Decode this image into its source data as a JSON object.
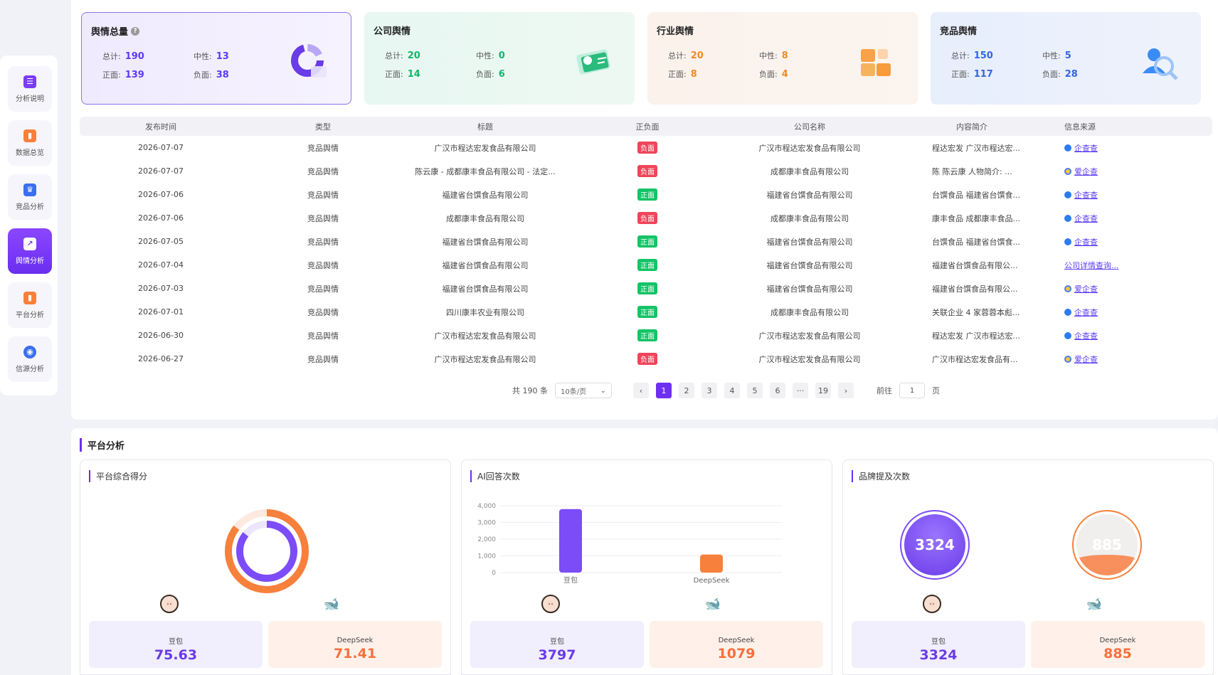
{
  "sidebar": {
    "items": [
      {
        "label": "分析说明",
        "icon": "document-icon",
        "color": "#7b3cf5",
        "active": false
      },
      {
        "label": "数据总览",
        "icon": "bar-chart-icon",
        "color": "#f7803c",
        "active": false
      },
      {
        "label": "竞品分析",
        "icon": "trophy-icon",
        "color": "#3b6ef0",
        "active": false
      },
      {
        "label": "舆情分析",
        "icon": "trend-icon",
        "color": "#ffffff",
        "active": true
      },
      {
        "label": "平台分析",
        "icon": "bar-chart-icon",
        "color": "#f7803c",
        "active": false
      },
      {
        "label": "信源分析",
        "icon": "signal-icon",
        "color": "#3b6ef0",
        "active": false
      }
    ]
  },
  "cards": [
    {
      "title": "舆情总量",
      "help": "?",
      "total_label": "总计:",
      "total": "190",
      "neutral_label": "中性:",
      "neutral": "13",
      "pos_label": "正面:",
      "pos": "139",
      "neg_label": "负面:",
      "neg": "38",
      "color": "#5b3cf5"
    },
    {
      "title": "公司舆情",
      "total_label": "总计:",
      "total": "20",
      "neutral_label": "中性:",
      "neutral": "0",
      "pos_label": "正面:",
      "pos": "14",
      "neg_label": "负面:",
      "neg": "6",
      "color": "#10b76a"
    },
    {
      "title": "行业舆情",
      "total_label": "总计:",
      "total": "20",
      "neutral_label": "中性:",
      "neutral": "8",
      "pos_label": "正面:",
      "pos": "8",
      "neg_label": "负面:",
      "neg": "4",
      "color": "#f58a1f"
    },
    {
      "title": "竞品舆情",
      "total_label": "总计:",
      "total": "150",
      "neutral_label": "中性:",
      "neutral": "5",
      "pos_label": "正面:",
      "pos": "117",
      "neg_label": "负面:",
      "neg": "28",
      "color": "#3366e0"
    }
  ],
  "table": {
    "headers": [
      "发布时间",
      "类型",
      "标题",
      "正负面",
      "公司名称",
      "内容简介",
      "信息来源"
    ],
    "rows": [
      {
        "date": "2026-07-07",
        "type": "竞品舆情",
        "title": "广汉市程达宏发食品有限公司",
        "sentiment": "负面",
        "company": "广汉市程达宏发食品有限公司",
        "summary": "程达宏发 广汉市程达宏...",
        "source": "企查查"
      },
      {
        "date": "2026-07-07",
        "type": "竞品舆情",
        "title": "陈云康 - 成都康丰食品有限公司 - 法定...",
        "sentiment": "负面",
        "company": "成都康丰食品有限公司",
        "summary": "陈 陈云康 人物简介: ...",
        "source": "爱企查"
      },
      {
        "date": "2026-07-06",
        "type": "竞品舆情",
        "title": "福建省台馔食品有限公司",
        "sentiment": "正面",
        "company": "福建省台馔食品有限公司",
        "summary": "台馔食品 福建省台馔食...",
        "source": "企查查"
      },
      {
        "date": "2026-07-06",
        "type": "竞品舆情",
        "title": "成都康丰食品有限公司",
        "sentiment": "负面",
        "company": "成都康丰食品有限公司",
        "summary": "康丰食品 成都康丰食品...",
        "source": "企查查"
      },
      {
        "date": "2026-07-05",
        "type": "竞品舆情",
        "title": "福建省台馔食品有限公司",
        "sentiment": "正面",
        "company": "福建省台馔食品有限公司",
        "summary": "台馔食品 福建省台馔食...",
        "source": "企查查"
      },
      {
        "date": "2026-07-04",
        "type": "竞品舆情",
        "title": "福建省台馔食品有限公司",
        "sentiment": "正面",
        "company": "福建省台馔食品有限公司",
        "summary": "福建省台馔食品有限公...",
        "source": "公司详情查询..."
      },
      {
        "date": "2026-07-03",
        "type": "竞品舆情",
        "title": "福建省台馔食品有限公司",
        "sentiment": "正面",
        "company": "福建省台馔食品有限公司",
        "summary": "福建省台馔食品有限公...",
        "source": "爱企查"
      },
      {
        "date": "2026-07-01",
        "type": "竞品舆情",
        "title": "四川康丰农业有限公司",
        "sentiment": "正面",
        "company": "成都康丰食品有限公司",
        "summary": "关联企业 4 家蓉蓉本彪...",
        "source": "企查查"
      },
      {
        "date": "2026-06-30",
        "type": "竞品舆情",
        "title": "广汉市程达宏发食品有限公司",
        "sentiment": "正面",
        "company": "广汉市程达宏发食品有限公司",
        "summary": "程达宏发 广汉市程达宏...",
        "source": "企查查"
      },
      {
        "date": "2026-06-27",
        "type": "竞品舆情",
        "title": "广汉市程达宏发食品有限公司",
        "sentiment": "负面",
        "company": "广汉市程达宏发食品有限公司",
        "summary": "广汉市程达宏发食品有...",
        "source": "爱企查"
      }
    ]
  },
  "pagination": {
    "total_text": "共 190 条",
    "page_size": "10条/页",
    "prev": "‹",
    "pages": [
      "1",
      "2",
      "3",
      "4",
      "5",
      "6",
      "···",
      "19"
    ],
    "current": "1",
    "next": "›",
    "goto_label": "前往",
    "goto_value": "1",
    "goto_unit": "页"
  },
  "platform": {
    "section_title": "平台分析",
    "score_card": {
      "title": "平台综合得分",
      "items": [
        {
          "name": "豆包",
          "value": "75.63"
        },
        {
          "name": "DeepSeek",
          "value": "71.41"
        }
      ]
    },
    "answers_card": {
      "title": "AI回答次数",
      "items": [
        {
          "name": "豆包",
          "value": "3797"
        },
        {
          "name": "DeepSeek",
          "value": "1079"
        }
      ]
    },
    "mentions_card": {
      "title": "品牌提及次数",
      "circle1": "3324",
      "circle2": "885",
      "items": [
        {
          "name": "豆包",
          "value": "3324"
        },
        {
          "name": "DeepSeek",
          "value": "885"
        }
      ]
    }
  },
  "chart_data": [
    {
      "type": "bar",
      "title": "AI回答次数",
      "categories": [
        "豆包",
        "DeepSeek"
      ],
      "values": [
        3797,
        1079
      ],
      "ylim": [
        0,
        4000
      ],
      "yticks": [
        "4,000",
        "3,000",
        "2,000",
        "1,000",
        "0"
      ],
      "colors": [
        "#7b4cf7",
        "#f7803c"
      ],
      "grid": true
    },
    {
      "type": "pie",
      "title": "平台综合得分",
      "categories": [
        "豆包",
        "DeepSeek"
      ],
      "values": [
        75.63,
        71.41
      ],
      "colors": [
        "#7b4cf7",
        "#f7803c"
      ]
    }
  ]
}
